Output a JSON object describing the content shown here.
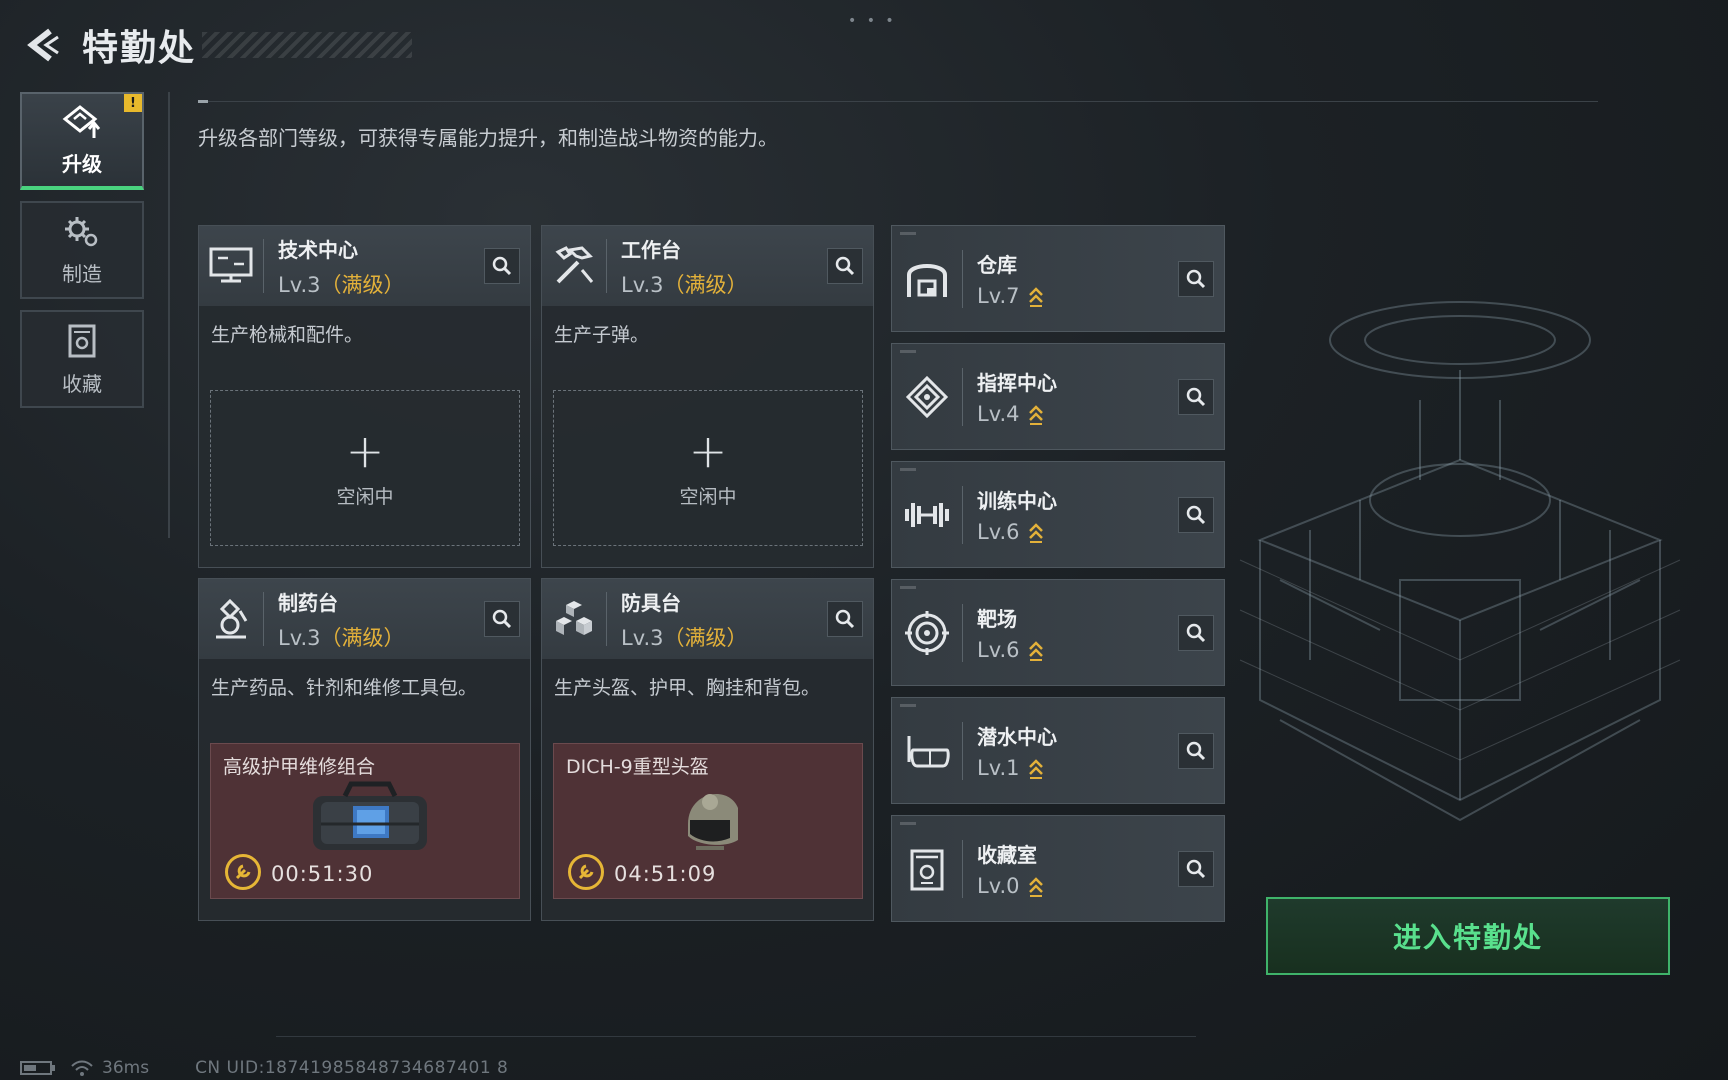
{
  "header": {
    "title": "特勤处",
    "back_icon": "back-arrow-icon"
  },
  "top_indicator": "• • •",
  "nav": {
    "items": [
      {
        "label": "升级",
        "icon": "upgrade-icon",
        "active": true,
        "badge": "!"
      },
      {
        "label": "制造",
        "icon": "gears-icon",
        "active": false
      },
      {
        "label": "收藏",
        "icon": "collection-icon",
        "active": false
      }
    ]
  },
  "description": "升级各部门等级，可获得专属能力提升，和制造战斗物资的能力。",
  "departments": [
    {
      "name": "技术中心",
      "level": "Lv.3",
      "max": "（满级）",
      "desc": "生产枪械和配件。",
      "slot": {
        "state": "idle",
        "plus": "+",
        "text": "空闲中"
      }
    },
    {
      "name": "工作台",
      "level": "Lv.3",
      "max": "（满级）",
      "desc": "生产子弹。",
      "slot": {
        "state": "idle",
        "plus": "+",
        "text": "空闲中"
      }
    },
    {
      "name": "制药台",
      "level": "Lv.3",
      "max": "（满级）",
      "desc": "生产药品、针剂和维修工具包。",
      "slot": {
        "state": "crafting",
        "item": "高级护甲维修组合",
        "timer": "00:51:30"
      }
    },
    {
      "name": "防具台",
      "level": "Lv.3",
      "max": "（满级）",
      "desc": "生产头盔、护甲、胸挂和背包。",
      "slot": {
        "state": "crafting",
        "item": "DICH-9重型头盔",
        "timer": "04:51:09"
      }
    }
  ],
  "facilities": [
    {
      "name": "仓库",
      "level": "Lv.7",
      "icon": "warehouse-icon"
    },
    {
      "name": "指挥中心",
      "level": "Lv.4",
      "icon": "command-center-icon"
    },
    {
      "name": "训练中心",
      "level": "Lv.6",
      "icon": "dumbbell-icon"
    },
    {
      "name": "靶场",
      "level": "Lv.6",
      "icon": "target-icon"
    },
    {
      "name": "潜水中心",
      "level": "Lv.1",
      "icon": "diving-mask-icon"
    },
    {
      "name": "收藏室",
      "level": "Lv.0",
      "icon": "collection-room-icon"
    }
  ],
  "enter_button": "进入特勤处",
  "status": {
    "ping": "36ms",
    "uid": "CN UID:18741985848734687401 8"
  },
  "colors": {
    "accent_green": "#59e08d",
    "max_level_gold": "#e3b13a",
    "craft_bg": "#4f3236"
  }
}
